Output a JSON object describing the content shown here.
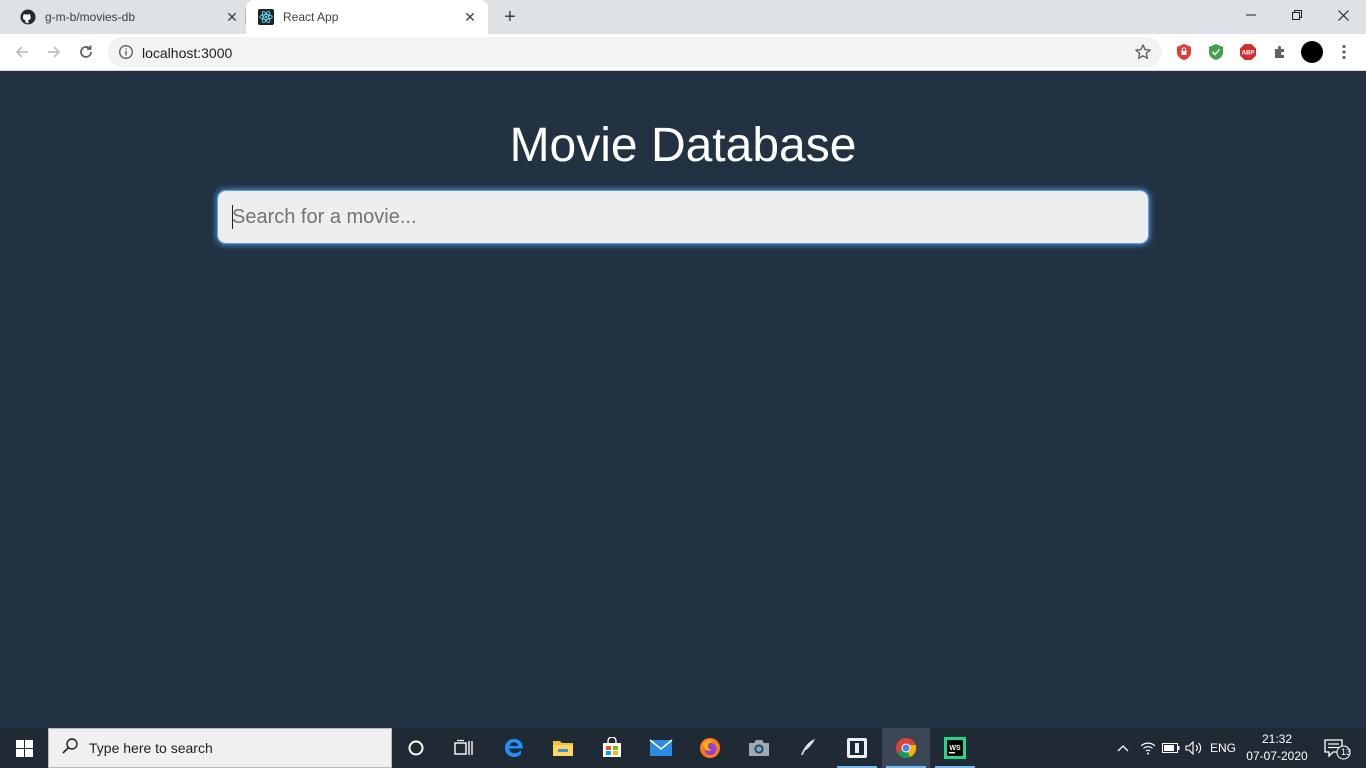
{
  "browser": {
    "tabs": [
      {
        "title": "g-m-b/movies-db",
        "icon": "github-icon"
      },
      {
        "title": "React App",
        "icon": "react-icon",
        "active": true
      }
    ],
    "url": "localhost:3000",
    "window_controls": [
      "minimize",
      "restore",
      "close"
    ]
  },
  "page": {
    "title": "Movie Database",
    "search_placeholder": "Search for a movie...",
    "background_color": "#223242",
    "accent_color": "#4a90d9"
  },
  "taskbar": {
    "search_placeholder": "Type here to search",
    "apps": [
      "cortana-icon",
      "task-view-icon",
      "edge-icon",
      "file-explorer-icon",
      "store-icon",
      "mail-icon",
      "firefox-icon",
      "camera-icon",
      "inkscape-icon",
      "app-icon",
      "chrome-icon",
      "webstorm-icon"
    ],
    "language": "ENG",
    "time": "21:32",
    "date": "07-07-2020",
    "notifications_count": "13"
  }
}
